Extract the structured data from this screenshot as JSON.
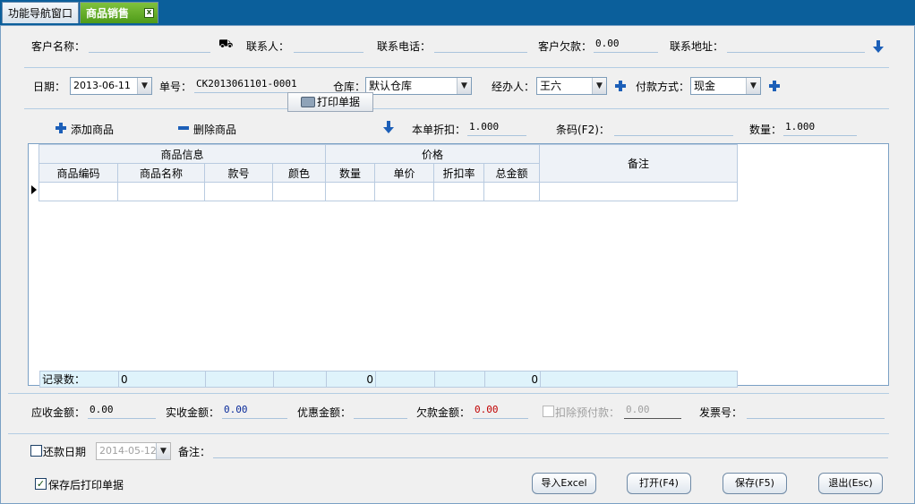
{
  "tabs": [
    {
      "label": "功能导航窗口"
    },
    {
      "label": "商品销售",
      "close": "x"
    }
  ],
  "customer": {
    "name_label": "客户名称：",
    "name_value": "",
    "contact_label": "联系人：",
    "contact_value": "",
    "phone_label": "联系电话：",
    "phone_value": "",
    "debt_label": "客户欠款：",
    "debt_value": "0.00",
    "address_label": "联系地址：",
    "address_value": ""
  },
  "order": {
    "date_label": "日期：",
    "date_value": "2013-06-11",
    "no_label": "单号：",
    "no_value": "CK2013061101-0001",
    "warehouse_label": "仓库：",
    "warehouse_value": "默认仓库",
    "handler_label": "经办人：",
    "handler_value": "王六",
    "pay_label": "付款方式：",
    "pay_value": "现金"
  },
  "toolbar": {
    "add_label": "添加商品",
    "delete_label": "删除商品",
    "print_label": "打印单据",
    "discount_label": "本单折扣：",
    "discount_value": "1.000",
    "barcode_label": "条码(F2)：",
    "barcode_value": "",
    "qty_label": "数量：",
    "qty_value": "1.000"
  },
  "grid": {
    "group_goods": "商品信息",
    "group_price": "价格",
    "remark": "备注",
    "columns": [
      "商品编码",
      "商品名称",
      "款号",
      "颜色",
      "数量",
      "单价",
      "折扣率",
      "总金额"
    ],
    "footer_label": "记录数：",
    "footer_count": "0",
    "footer_qty": "0",
    "footer_total": "0"
  },
  "summary": {
    "receivable_label": "应收金额：",
    "receivable_value": "0.00",
    "received_label": "实收金额：",
    "received_value": "0.00",
    "discount_amount_label": "优惠金额：",
    "discount_amount_value": "",
    "owed_label": "欠款金额：",
    "owed_value": "0.00",
    "deduct_label": "扣除预付款：",
    "deduct_value": "0.00",
    "invoice_label": "发票号：",
    "invoice_value": ""
  },
  "repay": {
    "date_label": "还款日期",
    "date_value": "2014-05-12",
    "remark_label": "备注：",
    "remark_value": ""
  },
  "footer": {
    "print_after_save_label": "保存后打印单据",
    "import_label": "导入Excel",
    "open_label": "打开(F4)",
    "save_label": "保存(F5)",
    "exit_label": "退出(Esc)"
  },
  "colors": {
    "received": "#0a2b9a",
    "owed": "#c00000",
    "accent": "#1c5fb8"
  }
}
